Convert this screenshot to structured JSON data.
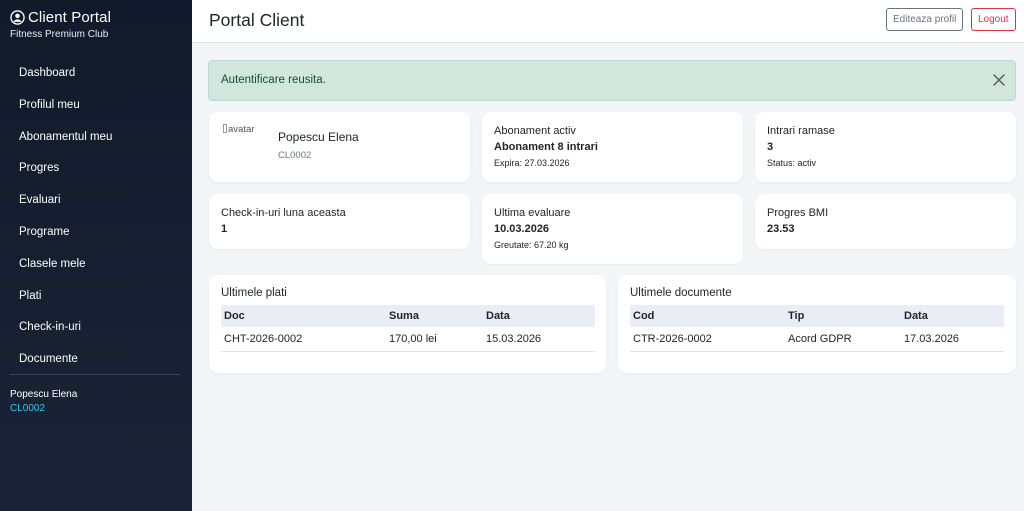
{
  "sidebar": {
    "brand_title": "Client Portal",
    "brand_subtitle": "Fitness Premium Club",
    "items": [
      {
        "label": "Dashboard"
      },
      {
        "label": "Profilul meu"
      },
      {
        "label": "Abonamentul meu"
      },
      {
        "label": "Progres"
      },
      {
        "label": "Evaluari"
      },
      {
        "label": "Programe"
      },
      {
        "label": "Clasele mele"
      },
      {
        "label": "Plati"
      },
      {
        "label": "Check-in-uri"
      },
      {
        "label": "Documente"
      }
    ],
    "user_name": "Popescu Elena",
    "user_code": "CL0002"
  },
  "header": {
    "title": "Portal Client",
    "edit_label": "Editeaza profil",
    "logout_label": "Logout"
  },
  "alert": {
    "message": "Autentificare reusita."
  },
  "profile": {
    "avatar_alt": "avatar",
    "name": "Popescu Elena",
    "code": "CL0002"
  },
  "subscription": {
    "label": "Abonament activ",
    "name": "Abonament 8 intrari",
    "expires": "Expira: 27.03.2026"
  },
  "entries": {
    "label": "Intrari ramase",
    "value": "3",
    "status": "Status: activ"
  },
  "checkins": {
    "label": "Check-in-uri luna aceasta",
    "value": "1"
  },
  "evaluation": {
    "label": "Ultima evaluare",
    "date": "10.03.2026",
    "weight": "Greutate: 67.20 kg"
  },
  "bmi": {
    "label": "Progres BMI",
    "value": "23.53"
  },
  "payments": {
    "title": "Ultimele plati",
    "headers": [
      "Doc",
      "Suma",
      "Data"
    ],
    "rows": [
      [
        "CHT-2026-0002",
        "170,00 lei",
        "15.03.2026"
      ]
    ]
  },
  "documents": {
    "title": "Ultimele documente",
    "headers": [
      "Cod",
      "Tip",
      "Data"
    ],
    "rows": [
      [
        "CTR-2026-0002",
        "Acord GDPR",
        "17.03.2026"
      ]
    ]
  },
  "colors": {
    "sidebar_bg": "#111a2b",
    "accent_code": "#2ec8f0",
    "alert_bg": "#d1e7dd",
    "logout": "#dc3545"
  },
  "icons": {
    "brand": "user-circle-icon",
    "alert_close": "close-icon"
  }
}
